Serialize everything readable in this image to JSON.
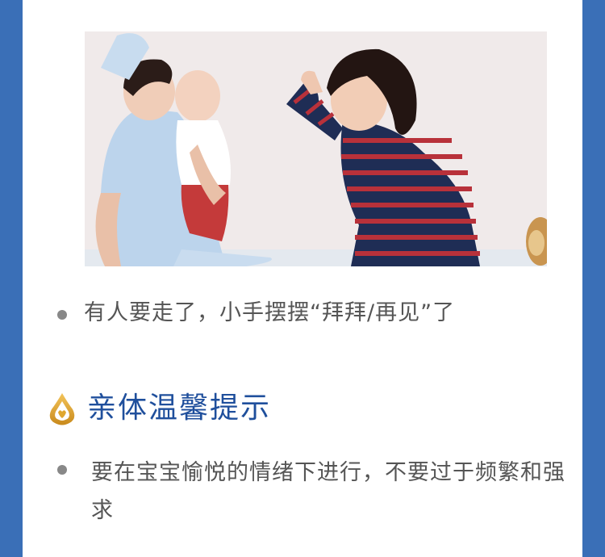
{
  "colors": {
    "frame": "#3a6fb7",
    "panel": "#ffffff",
    "title": "#1f4f9c",
    "body_text": "#555555",
    "bullet": "#888888",
    "icon_gold": "#e0a72e"
  },
  "photo": {
    "subject": "nurse holding a baby while a woman in a striped shirt waves goodbye"
  },
  "steps": {
    "item_1": "有人要走了，小手摆摆“拜拜/再见”了"
  },
  "tips": {
    "icon": "heart-drop-icon",
    "title": "亲体温馨提示",
    "item_1": "要在宝宝愉悦的情绪下进行，不要过于频繁和强求"
  }
}
